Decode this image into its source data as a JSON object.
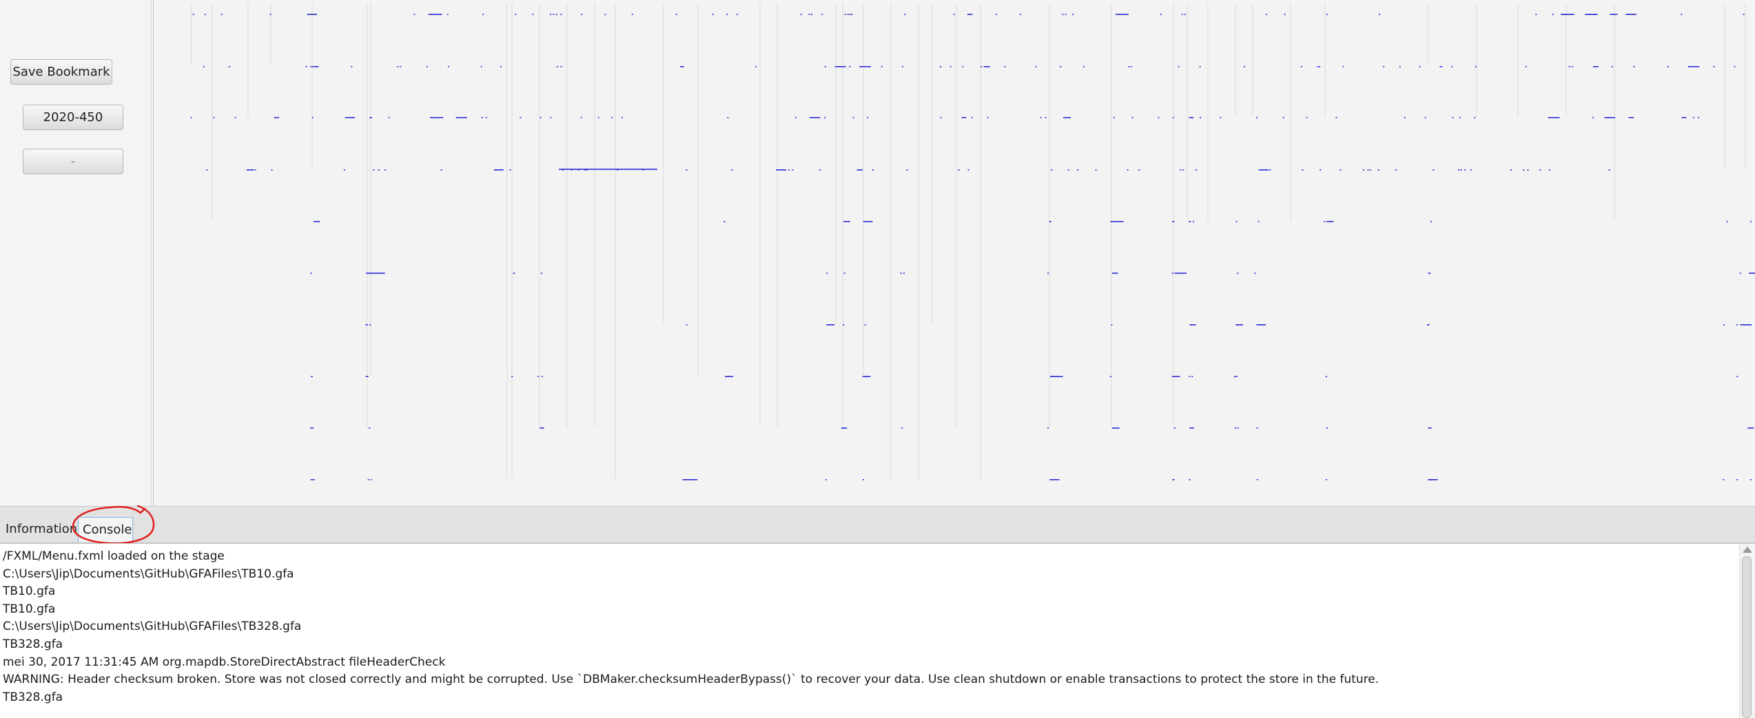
{
  "left_panel": {
    "save_bookmark_label": "Save Bookmark",
    "bookmark_buttons": [
      "2020-450",
      "-"
    ]
  },
  "tabs": [
    {
      "label": "Information",
      "selected": false
    },
    {
      "label": "Console",
      "selected": true
    }
  ],
  "console": {
    "lines": [
      "/FXML/Menu.fxml loaded on the stage",
      "C:\\Users\\Jip\\Documents\\GitHub\\GFAFiles\\TB10.gfa",
      "TB10.gfa",
      "TB10.gfa",
      "C:\\Users\\Jip\\Documents\\GitHub\\GFAFiles\\TB328.gfa",
      "TB328.gfa",
      "mei 30, 2017 11:31:45 AM org.mapdb.StoreDirectAbstract fileHeaderCheck",
      "WARNING: Header checksum broken. Store was not closed correctly and might be corrupted. Use `DBMaker.checksumHeaderBypass()` to recover your data. Use clean shutdown or enable transactions to protect the store in the future.",
      "TB328.gfa"
    ]
  },
  "colors": {
    "node_color": "#2b2bd8",
    "edge_color": "#d2d2d2",
    "annotation_color": "#e01e1e",
    "tab_focus": "#7fb3e6"
  },
  "icons": {
    "scroll_up": "triangle-up"
  }
}
